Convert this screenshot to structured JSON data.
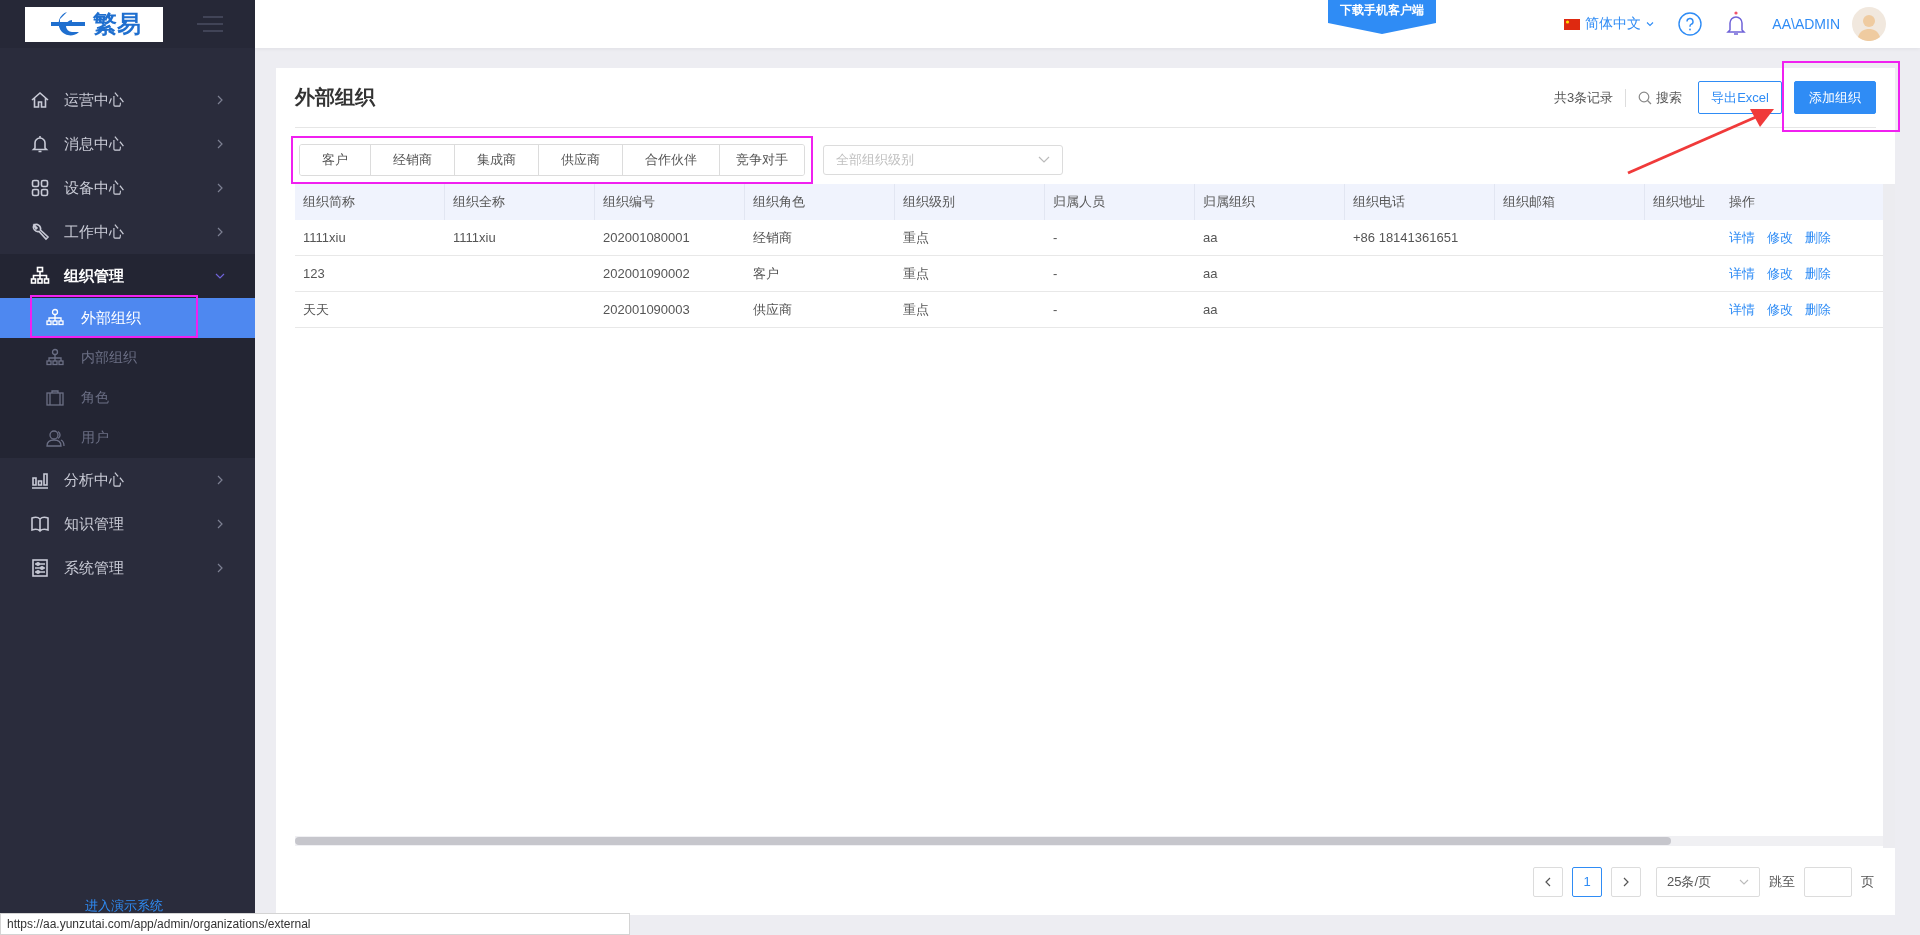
{
  "logo": {
    "text": "繁易"
  },
  "sidebar": {
    "items": [
      {
        "label": "运营中心",
        "expanded": false
      },
      {
        "label": "消息中心",
        "expanded": false
      },
      {
        "label": "设备中心",
        "expanded": false
      },
      {
        "label": "工作中心",
        "expanded": false
      },
      {
        "label": "组织管理",
        "expanded": true,
        "children": [
          {
            "label": "外部组织",
            "selected": true
          },
          {
            "label": "内部组织",
            "selected": false
          },
          {
            "label": "角色",
            "selected": false
          },
          {
            "label": "用户",
            "selected": false
          }
        ]
      },
      {
        "label": "分析中心",
        "expanded": false
      },
      {
        "label": "知识管理",
        "expanded": false
      },
      {
        "label": "系统管理",
        "expanded": false
      }
    ],
    "footer_link": "进入演示系统"
  },
  "topbar": {
    "download_banner": "下载手机客户端",
    "language": "简体中文",
    "user": "AA\\ADMIN"
  },
  "page": {
    "title": "外部组织",
    "record_count": "共3条记录",
    "search": "搜索",
    "buttons": [
      {
        "label": "导出Excel",
        "kind": "outline"
      },
      {
        "label": "添加组织",
        "kind": "primary"
      }
    ]
  },
  "filters": {
    "tabs": [
      {
        "label": "客户",
        "selected": false
      },
      {
        "label": "经销商",
        "selected": false
      },
      {
        "label": "集成商",
        "selected": false
      },
      {
        "label": "供应商",
        "selected": false
      },
      {
        "label": "合作伙伴",
        "selected": false
      },
      {
        "label": "竞争对手",
        "selected": false
      }
    ],
    "level_select": {
      "placeholder": "全部组织级别"
    }
  },
  "table": {
    "columns": [
      "组织简称",
      "组织全称",
      "组织编号",
      "组织角色",
      "组织级别",
      "归属人员",
      "归属组织",
      "组织电话",
      "组织邮箱",
      "组织地址",
      "操作"
    ],
    "rows": [
      {
        "cells": [
          "1111xiu",
          "1111xiu",
          "202001080001",
          "经销商",
          "重点",
          "-",
          "aa",
          "+86 18141361651",
          "",
          ""
        ],
        "actions": [
          "详情",
          "修改",
          "删除"
        ]
      },
      {
        "cells": [
          "123",
          "",
          "202001090002",
          "客户",
          "重点",
          "-",
          "aa",
          "",
          "",
          ""
        ],
        "actions": [
          "详情",
          "修改",
          "删除"
        ]
      },
      {
        "cells": [
          "天天",
          "",
          "202001090003",
          "供应商",
          "重点",
          "-",
          "aa",
          "",
          "",
          ""
        ],
        "actions": [
          "详情",
          "修改",
          "删除"
        ]
      }
    ]
  },
  "pagination": {
    "pages": [
      {
        "label": "1",
        "selected": true
      }
    ],
    "page_size": "25条/页",
    "jump_label": "跳至",
    "page_suffix": "页"
  },
  "status_url": "https://aa.yunzutai.com/app/admin/organizations/external"
}
